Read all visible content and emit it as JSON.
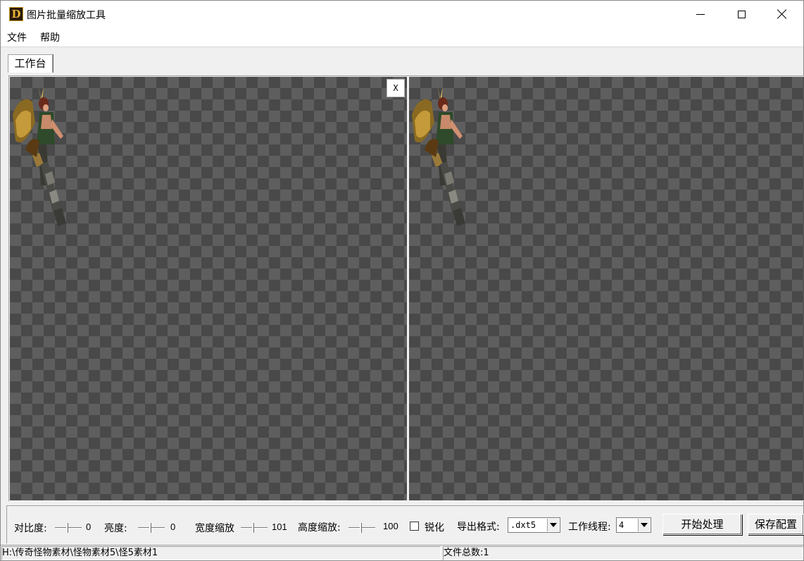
{
  "window": {
    "title": "图片批量缩放工具",
    "app_icon_letter": "D",
    "controls": [
      "minimize-icon",
      "maximize-icon",
      "close-icon"
    ]
  },
  "menu": {
    "items": [
      "文件",
      "帮助"
    ]
  },
  "tabs": {
    "active": "工作台"
  },
  "preview": {
    "close_label": "X",
    "image": "monster-sprite"
  },
  "controls": {
    "contrast": {
      "label": "对比度:",
      "value": "0"
    },
    "brightness": {
      "label": "亮度:",
      "value": "0"
    },
    "width_scale": {
      "label": "宽度缩放",
      "value": "101"
    },
    "height_scale": {
      "label": "高度缩放:",
      "value": "100"
    },
    "sharpen": {
      "label": "锐化",
      "checked": false
    },
    "export_format": {
      "label": "导出格式:",
      "value": ".dxt5"
    },
    "threads": {
      "label": "工作线程:",
      "value": "4"
    },
    "start_button": "开始处理",
    "save_button": "保存配置"
  },
  "status": {
    "path": "H:\\传奇怪物素材\\怪物素材5\\怪5素材1",
    "file_count_label": "文件总数:",
    "file_count": "1"
  }
}
